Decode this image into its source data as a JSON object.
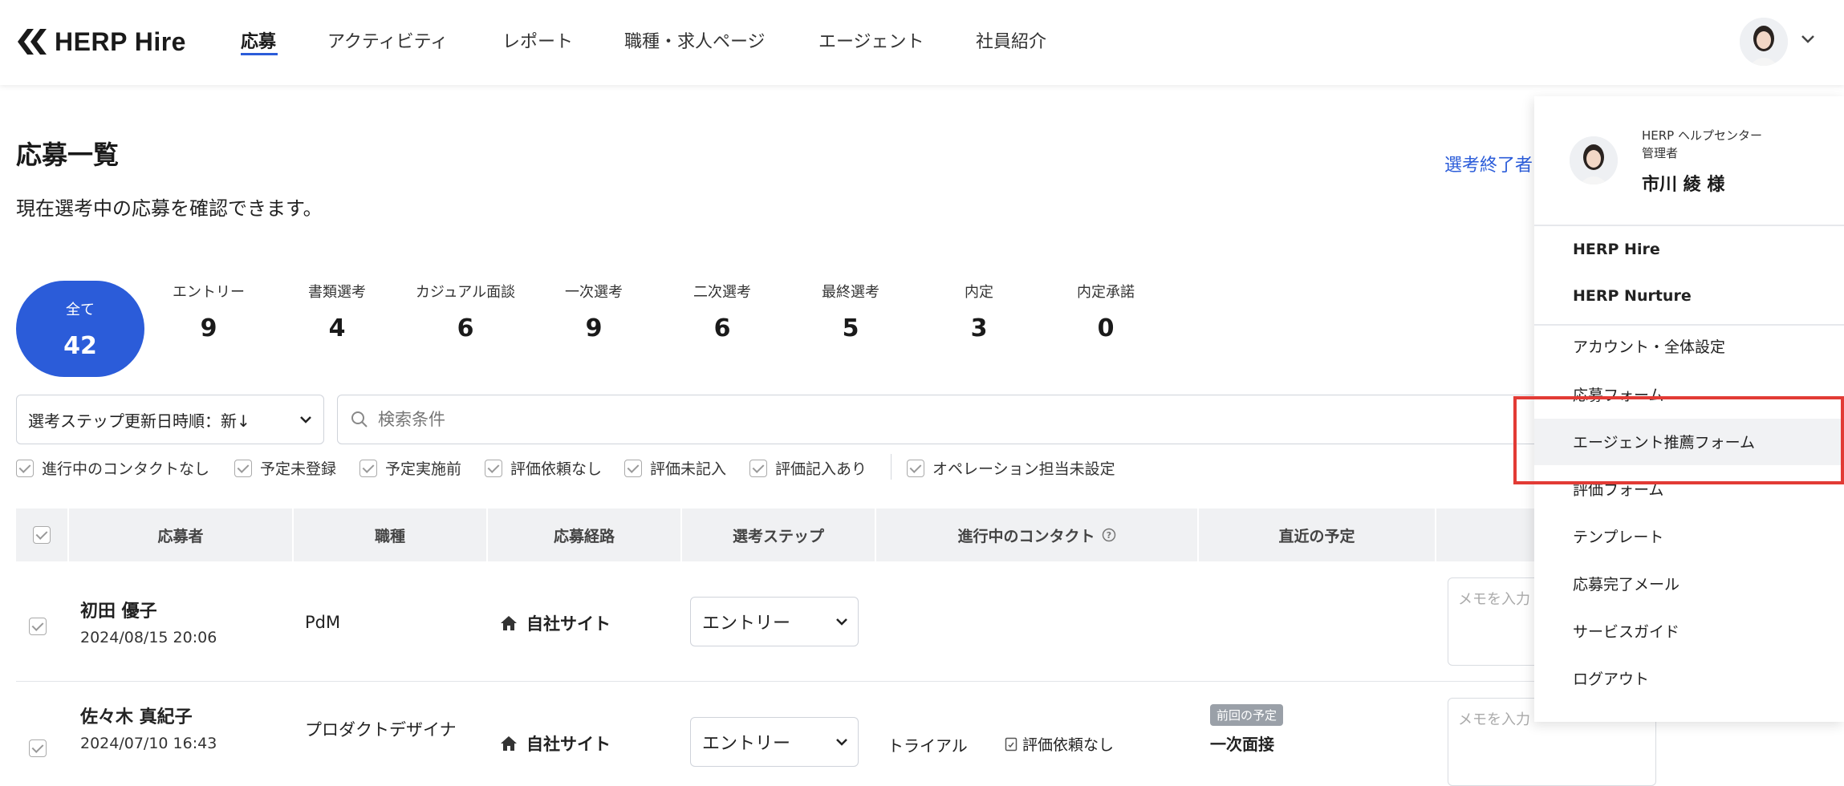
{
  "header": {
    "logo_text": "HERP Hire",
    "nav": [
      {
        "label": "応募",
        "active": true
      },
      {
        "label": "アクティビティ"
      },
      {
        "label": "レポート"
      },
      {
        "label": "職種・求人ページ"
      },
      {
        "label": "エージェント"
      },
      {
        "label": "社員紹介"
      }
    ]
  },
  "page": {
    "title": "応募一覧",
    "description": "現在選考中の応募を確認できます。",
    "ended_link": "選考終了者"
  },
  "steps": [
    {
      "label": "全て",
      "count": "42"
    },
    {
      "label": "エントリー",
      "count": "9"
    },
    {
      "label": "書類選考",
      "count": "4"
    },
    {
      "label": "カジュアル面談",
      "count": "6"
    },
    {
      "label": "一次選考",
      "count": "9"
    },
    {
      "label": "二次選考",
      "count": "6"
    },
    {
      "label": "最終選考",
      "count": "5"
    },
    {
      "label": "内定",
      "count": "3"
    },
    {
      "label": "内定承諾",
      "count": "0"
    }
  ],
  "toolbar": {
    "sort_value": "選考ステップ更新日時順：新↓",
    "search_placeholder": "検索条件"
  },
  "filters": [
    "進行中のコンタクトなし",
    "予定未登録",
    "予定実施前",
    "評価依頼なし",
    "評価未記入",
    "評価記入あり",
    "オペレーション担当未設定"
  ],
  "table": {
    "columns": [
      "応募者",
      "職種",
      "応募経路",
      "選考ステップ",
      "進行中のコンタクト",
      "直近の予定"
    ],
    "rows": [
      {
        "name": "初田 優子",
        "date": "2024/08/15 20:06",
        "job": "PdM",
        "route": "自社サイト",
        "step": "エントリー",
        "contact": "",
        "eval": "",
        "badge": "",
        "schedule": "",
        "memo": "メモを入力"
      },
      {
        "name": "佐々木 真紀子",
        "date": "2024/07/10 16:43",
        "job": "プロダクトデザイナ",
        "route": "自社サイト",
        "step": "エントリー",
        "contact": "トライアル",
        "eval": "評価依頼なし",
        "badge": "前回の予定",
        "schedule": "一次面接",
        "memo": "メモを入力"
      }
    ]
  },
  "dropdown": {
    "org": "HERP ヘルプセンター",
    "role": "管理者",
    "user": "市川 綾 様",
    "products": [
      "HERP Hire",
      "HERP Nurture"
    ],
    "items": [
      "アカウント・全体設定",
      "応募フォーム",
      "エージェント推薦フォーム",
      "評価フォーム",
      "テンプレート",
      "応募完了メール",
      "サービスガイド",
      "ログアウト"
    ]
  },
  "colors": {
    "accent": "#2b5cd9",
    "highlight": "#e23b35"
  }
}
